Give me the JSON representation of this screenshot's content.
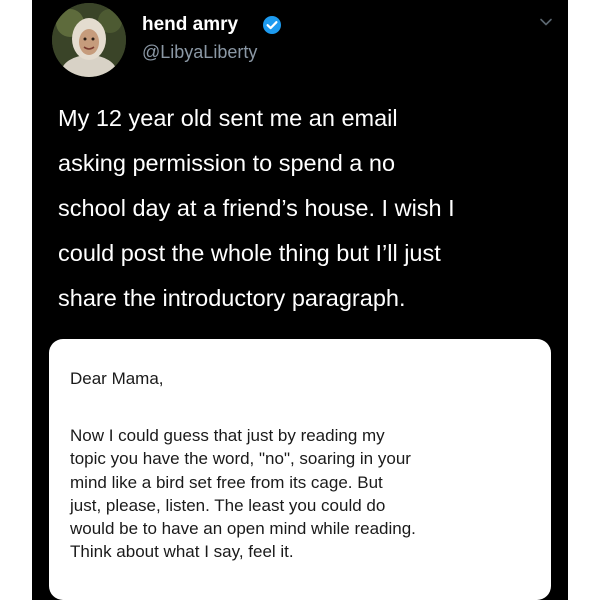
{
  "tweet": {
    "author": {
      "display_name": "hend amry",
      "handle": "@LibyaLiberty",
      "verified": true
    },
    "text_lines": [
      "My 12 year old sent me an email",
      "asking permission to spend a no",
      "school day at a friend’s house. I wish I",
      "could post the whole thing but I’ll just",
      "share the introductory paragraph."
    ],
    "attached_image": {
      "greeting": "Dear Mama,",
      "body_lines": [
        "Now I could guess that just by reading my",
        "topic you have the word, \"no\", soaring in your",
        "mind like a bird set free from its cage. But",
        "just, please, listen. The least you could do",
        "would be to have an open mind while reading.",
        "Think about what I say, feel it."
      ]
    }
  },
  "colors": {
    "background": "#000000",
    "primary_text": "#ffffff",
    "secondary_text": "#8b98a5",
    "verified_badge": "#1d9bf0",
    "email_card": "#ffffff",
    "email_text": "#1a1a1a"
  },
  "icons": {
    "verified": "verified-badge-icon",
    "menu": "chevron-down-icon"
  }
}
